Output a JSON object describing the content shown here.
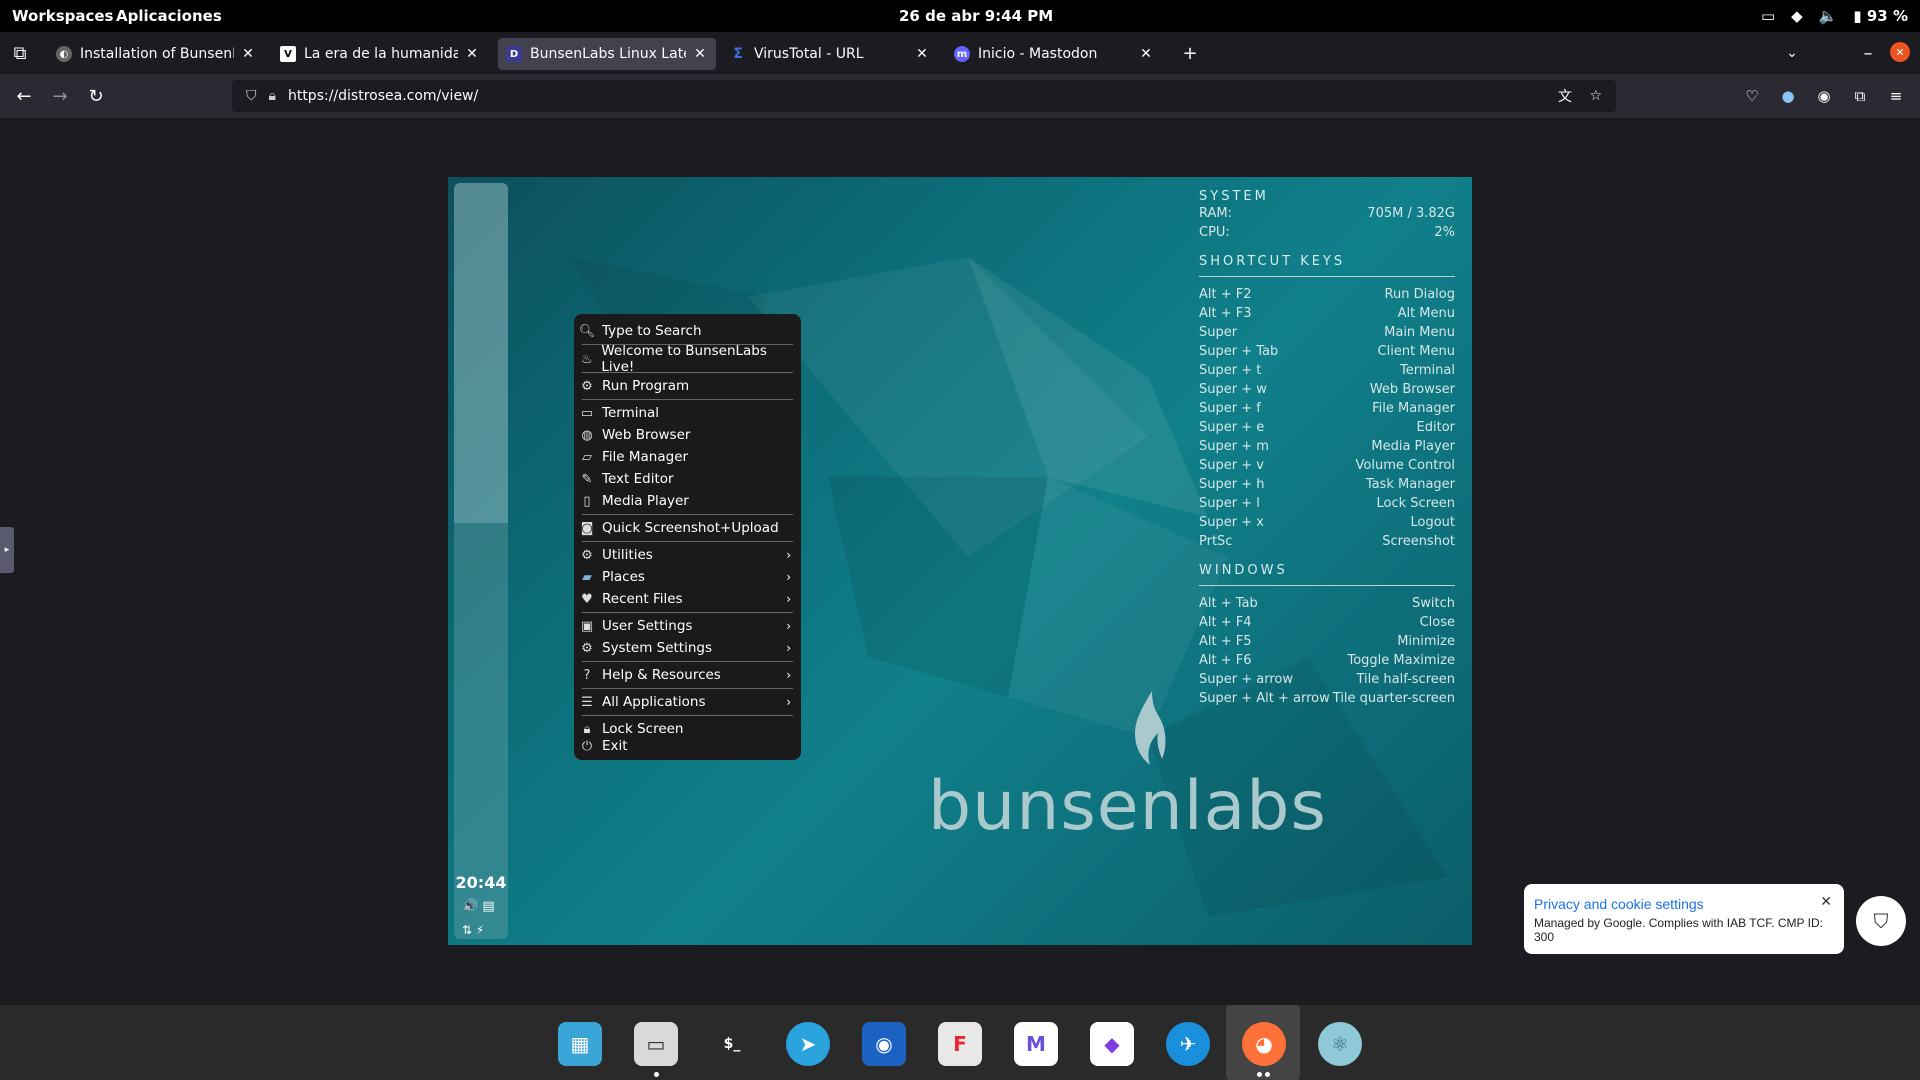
{
  "topbar": {
    "workspaces": "Workspaces",
    "applications": "Aplicaciones",
    "datetime": "26 de abr  9:44 PM",
    "battery": "93 %"
  },
  "tabs": [
    {
      "title": "Installation of BunsenLabs",
      "favicon": "globe-icon",
      "favicon_letter": ""
    },
    {
      "title": "La era de la humanidad | M",
      "favicon": "v-icon",
      "favicon_letter": "V"
    },
    {
      "title": "BunsenLabs Linux Latest - D",
      "favicon": "d-icon",
      "favicon_letter": "D"
    },
    {
      "title": "VirusTotal - URL",
      "favicon": "virustotal-icon",
      "favicon_letter": "Σ"
    },
    {
      "title": "Inicio - Mastodon",
      "favicon": "mastodon-icon",
      "favicon_letter": "m"
    }
  ],
  "url": "https://distrosea.com/view/",
  "desktop": {
    "clock": "20:44",
    "logo_text": "bunsenlabs"
  },
  "conky": {
    "system_heading": "SYSTEM",
    "system": [
      {
        "key": "RAM:",
        "value": "705M / 3.82G"
      },
      {
        "key": "CPU:",
        "value": "2%"
      }
    ],
    "shortcut_heading": "SHORTCUT KEYS",
    "shortcuts": [
      {
        "key": "Alt + F2",
        "value": "Run Dialog"
      },
      {
        "key": "Alt + F3",
        "value": "Alt Menu"
      },
      {
        "key": "Super",
        "value": "Main Menu"
      },
      {
        "key": "Super + Tab",
        "value": "Client Menu"
      },
      {
        "key": "Super + t",
        "value": "Terminal"
      },
      {
        "key": "Super + w",
        "value": "Web Browser"
      },
      {
        "key": "Super + f",
        "value": "File Manager"
      },
      {
        "key": "Super + e",
        "value": "Editor"
      },
      {
        "key": "Super + m",
        "value": "Media Player"
      },
      {
        "key": "Super + v",
        "value": "Volume Control"
      },
      {
        "key": "Super + h",
        "value": "Task Manager"
      },
      {
        "key": "Super + l",
        "value": "Lock Screen"
      },
      {
        "key": "Super + x",
        "value": "Logout"
      },
      {
        "key": "PrtSc",
        "value": "Screenshot"
      }
    ],
    "windows_heading": "WINDOWS",
    "windows": [
      {
        "key": "Alt + Tab",
        "value": "Switch"
      },
      {
        "key": "Alt + F4",
        "value": "Close"
      },
      {
        "key": "Alt + F5",
        "value": "Minimize"
      },
      {
        "key": "Alt + F6",
        "value": "Toggle Maximize"
      },
      {
        "key": "Super + arrow",
        "value": "Tile half-screen"
      },
      {
        "key": "Super + Alt + arrow",
        "value": "Tile quarter-screen"
      }
    ]
  },
  "menu": {
    "search": "Type to Search",
    "welcome": "Welcome to BunsenLabs Live!",
    "run_program": "Run Program",
    "terminal": "Terminal",
    "web_browser": "Web Browser",
    "file_manager": "File Manager",
    "text_editor": "Text Editor",
    "media_player": "Media Player",
    "screenshot": "Quick Screenshot+Upload",
    "utilities": "Utilities",
    "places": "Places",
    "recent_files": "Recent Files",
    "user_settings": "User Settings",
    "system_settings": "System Settings",
    "help": "Help & Resources",
    "all_apps": "All Applications",
    "lock_screen": "Lock Screen",
    "exit": "Exit"
  },
  "privacy": {
    "title": "Privacy and cookie settings",
    "desc": "Managed by Google. Complies with IAB TCF. CMP ID: 300"
  },
  "dock": [
    {
      "name": "dock-app-1",
      "color": "#3aa6d8"
    },
    {
      "name": "dock-files",
      "color": "#d9d9d9"
    },
    {
      "name": "dock-terminal",
      "color": "#2a2a2a"
    },
    {
      "name": "dock-telegram",
      "color": "#2aa3dd"
    },
    {
      "name": "dock-app-5",
      "color": "#1b62c2"
    },
    {
      "name": "dock-app-6",
      "color": "#e8e8e8"
    },
    {
      "name": "dock-mail",
      "color": "#ffffff"
    },
    {
      "name": "dock-app-8",
      "color": "#ffffff"
    },
    {
      "name": "dock-app-9",
      "color": "#1a8fdc"
    },
    {
      "name": "dock-firefox",
      "color": "#ff7139"
    },
    {
      "name": "dock-app-11",
      "color": "#8fc8d8"
    }
  ]
}
